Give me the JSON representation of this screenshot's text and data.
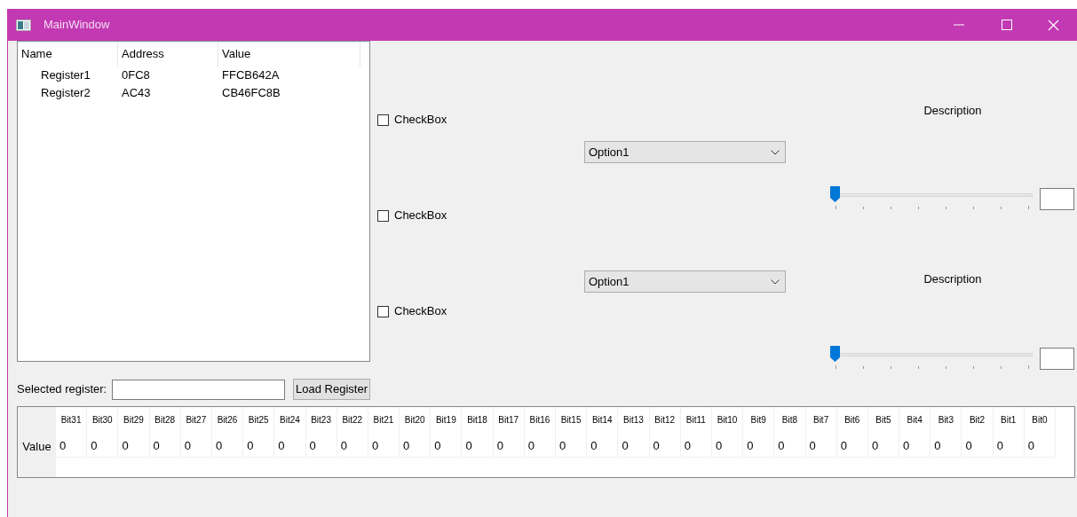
{
  "window": {
    "title": "MainWindow"
  },
  "register_tree": {
    "columns": [
      "Name",
      "Address",
      "Value"
    ],
    "rows": [
      {
        "cells": [
          "Register1",
          "0FC8",
          "FFCB642A"
        ]
      },
      {
        "cells": [
          "Register2",
          "AC43",
          "CB46FC8B"
        ]
      }
    ]
  },
  "checkboxes": [
    {
      "label": "CheckBox",
      "checked": false
    },
    {
      "label": "CheckBox",
      "checked": false
    },
    {
      "label": "CheckBox",
      "checked": false
    }
  ],
  "comboboxes": [
    {
      "value": "Option1"
    },
    {
      "value": "Option1"
    }
  ],
  "settings": [
    {
      "description": "Description",
      "level": 0
    },
    {
      "description": "Description",
      "level": 0
    }
  ],
  "selected_register": {
    "label": "Selected register:"
  },
  "load_button": "Load Register",
  "bit_table": {
    "row_header": "Value",
    "columns": [
      "Bit31",
      "Bit30",
      "Bit29",
      "Bit28",
      "Bit27",
      "Bit26",
      "Bit25",
      "Bit24",
      "Bit23",
      "Bit22",
      "Bit21",
      "Bit20",
      "Bit19",
      "Bit18",
      "Bit17",
      "Bit16",
      "Bit15",
      "Bit14",
      "Bit13",
      "Bit12",
      "Bit11",
      "Bit10",
      "Bit9",
      "Bit8",
      "Bit7",
      "Bit6",
      "Bit5",
      "Bit4",
      "Bit3",
      "Bit2",
      "Bit1",
      "Bit0"
    ],
    "values": [
      "0",
      "0",
      "0",
      "0",
      "0",
      "0",
      "0",
      "0",
      "0",
      "0",
      "0",
      "0",
      "0",
      "0",
      "0",
      "0",
      "0",
      "0",
      "0",
      "0",
      "0",
      "0",
      "0",
      "0",
      "0",
      "0",
      "0",
      "0",
      "0",
      "0",
      "0",
      "0"
    ]
  }
}
